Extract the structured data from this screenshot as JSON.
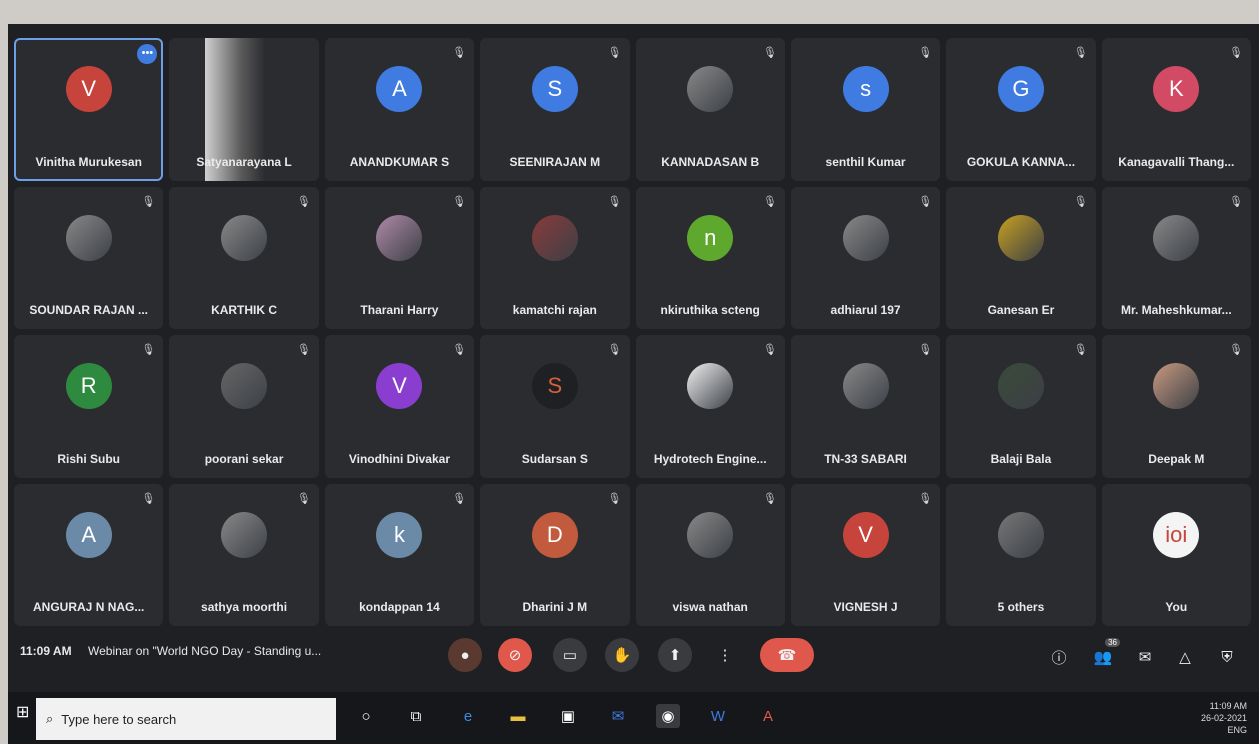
{
  "participants": [
    {
      "name": "Vinitha Murukesan",
      "avatar": "V",
      "color": "#c6443c",
      "active": true,
      "more": "•••"
    },
    {
      "name": "Satyanarayana L",
      "avatar": "",
      "color": "",
      "video": true
    },
    {
      "name": "ANANDKUMAR S",
      "avatar": "A",
      "color": "#3f7be0"
    },
    {
      "name": "SEENIRAJAN M",
      "avatar": "S",
      "color": "#3f7be0"
    },
    {
      "name": "KANNADASAN B",
      "avatar": "",
      "color": "#888"
    },
    {
      "name": "senthil Kumar",
      "avatar": "s",
      "color": "#3f7be0"
    },
    {
      "name": "GOKULA KANNA...",
      "avatar": "G",
      "color": "#3f7be0"
    },
    {
      "name": "Kanagavalli Thang...",
      "avatar": "K",
      "color": "#d24a64"
    },
    {
      "name": "SOUNDAR RAJAN ...",
      "avatar": "",
      "color": "#888"
    },
    {
      "name": "KARTHIK C",
      "avatar": "",
      "color": "#888"
    },
    {
      "name": "Tharani Harry",
      "avatar": "",
      "color": "#b08aa8"
    },
    {
      "name": "kamatchi rajan",
      "avatar": "",
      "color": "#8a3a3a"
    },
    {
      "name": "nkiruthika scteng",
      "avatar": "n",
      "color": "#5ea82e"
    },
    {
      "name": "adhiarul 197",
      "avatar": "",
      "color": "#888"
    },
    {
      "name": "Ganesan Er",
      "avatar": "",
      "color": "#c8a020"
    },
    {
      "name": "Mr. Maheshkumar...",
      "avatar": "",
      "color": "#888"
    },
    {
      "name": "Rishi Subu",
      "avatar": "R",
      "color": "#2e8a3e"
    },
    {
      "name": "poorani sekar",
      "avatar": "",
      "color": "#666"
    },
    {
      "name": "Vinodhini Divakar",
      "avatar": "V",
      "color": "#8a3ed0"
    },
    {
      "name": "Sudarsan S",
      "avatar": "S",
      "color": "#1f2024",
      "fg": "#d8603a"
    },
    {
      "name": "Hydrotech Engine...",
      "avatar": "",
      "color": "#f0f0f0"
    },
    {
      "name": "TN-33 SABARI",
      "avatar": "",
      "color": "#888"
    },
    {
      "name": "Balaji Bala",
      "avatar": "",
      "color": "#3a4a3a"
    },
    {
      "name": "Deepak M",
      "avatar": "",
      "color": "#c89a80"
    },
    {
      "name": "ANGURAJ N NAG...",
      "avatar": "A",
      "color": "#6a8aa8"
    },
    {
      "name": "sathya moorthi",
      "avatar": "",
      "color": "#888"
    },
    {
      "name": "kondappan 14",
      "avatar": "k",
      "color": "#6a8aa8"
    },
    {
      "name": "Dharini J M",
      "avatar": "D",
      "color": "#c25a3e"
    },
    {
      "name": "viswa nathan",
      "avatar": "",
      "color": "#888"
    },
    {
      "name": "VIGNESH J",
      "avatar": "V",
      "color": "#c6443c"
    },
    {
      "name": "5 others",
      "avatar": "",
      "color": "#777"
    },
    {
      "name": "You",
      "avatar": "ioi",
      "color": "#f4f4f4",
      "fg": "#c6443c"
    }
  ],
  "meeting": {
    "time": "11:09 AM",
    "title": "Webinar on \"World NGO Day - Standing u..."
  },
  "right_controls": {
    "people_count": "36"
  },
  "taskbar": {
    "search_placeholder": "Type here to search",
    "tray_time": "11:09 AM",
    "tray_date": "26-02-2021",
    "tray_lang": "ENG"
  }
}
